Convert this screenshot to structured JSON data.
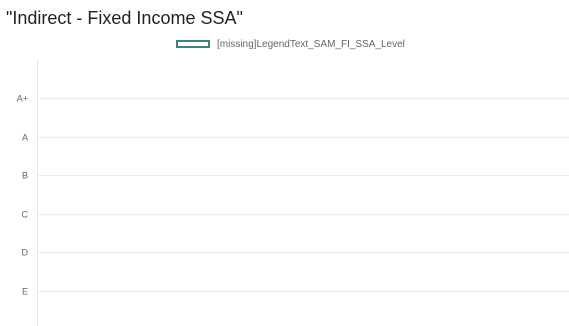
{
  "chart_data": {
    "type": "line",
    "title": "\"Indirect - Fixed Income SSA\"",
    "legend": {
      "placement": "top-center",
      "entries": [
        "[missing]LegendText_SAM_FI_SSA_Level"
      ]
    },
    "categories": [
      "A+",
      "A",
      "B",
      "C",
      "D",
      "E"
    ],
    "series": [
      {
        "name": "[missing]LegendText_SAM_FI_SSA_Level",
        "color": "#3f7f86",
        "values": []
      }
    ],
    "grid": true,
    "xlabel": "",
    "ylabel": ""
  }
}
